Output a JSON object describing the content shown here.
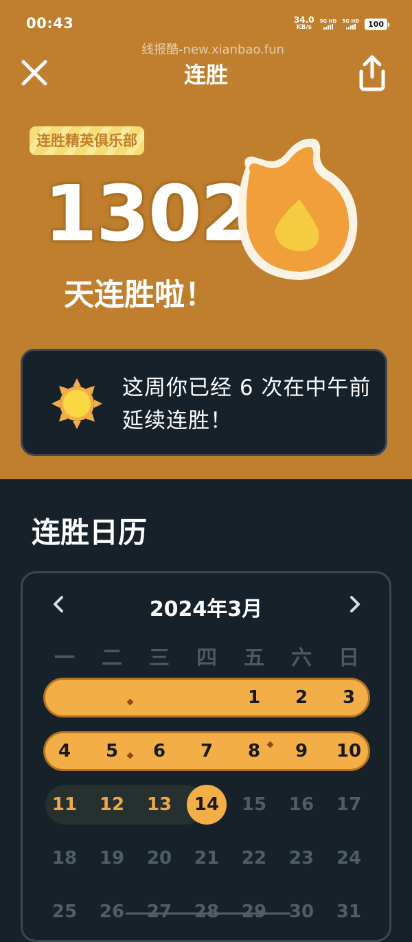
{
  "status": {
    "time": "00:43",
    "speed_value": "34.0",
    "speed_unit": "KB/s",
    "sig1": "5G HD",
    "sig2": "5G HD",
    "battery": "100"
  },
  "watermark": "线报酷-new.xianbao.fun",
  "header": {
    "title": "连胜",
    "close_icon": "close-icon",
    "share_icon": "share-icon"
  },
  "hero": {
    "club_badge": "连胜精英俱乐部",
    "streak_count": "1302",
    "streak_label": "天连胜啦！",
    "flame_icon": "flame-icon"
  },
  "message": {
    "icon": "sun-icon",
    "text": "这周你已经 6 次在中午前延续连胜！"
  },
  "calendar": {
    "section_title": "连胜日历",
    "month": "2024年3月",
    "weekdays": [
      "一",
      "二",
      "三",
      "四",
      "五",
      "六",
      "日"
    ],
    "rows": [
      [
        "",
        "",
        "",
        "",
        "1",
        "2",
        "3"
      ],
      [
        "4",
        "5",
        "6",
        "7",
        "8",
        "9",
        "10"
      ],
      [
        "11",
        "12",
        "13",
        "14",
        "15",
        "16",
        "17"
      ],
      [
        "18",
        "19",
        "20",
        "21",
        "22",
        "23",
        "24"
      ],
      [
        "25",
        "26",
        "27",
        "28",
        "29",
        "30",
        "31"
      ]
    ],
    "today": "14"
  },
  "colors": {
    "header_bg": "#c07f2e",
    "page_bg": "#17212a",
    "streak_orange": "#f3ae48",
    "badge_yellow": "#f7dd77"
  }
}
